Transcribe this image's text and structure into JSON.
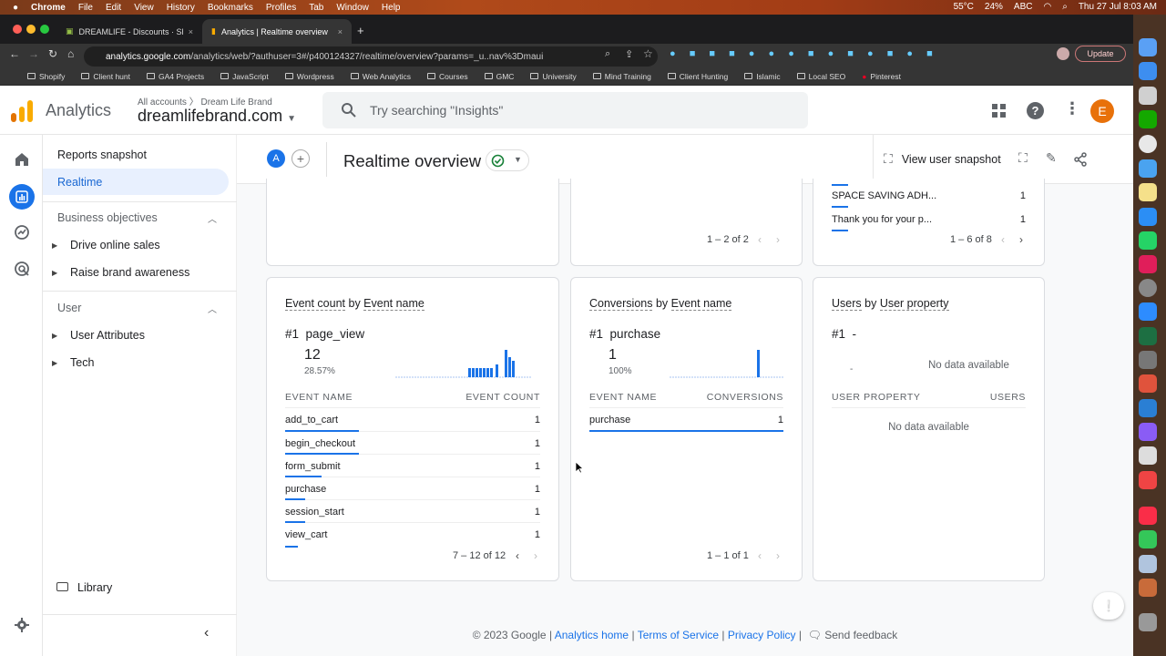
{
  "menubar": {
    "app": "Chrome",
    "items": [
      "File",
      "Edit",
      "View",
      "History",
      "Bookmarks",
      "Profiles",
      "Tab",
      "Window",
      "Help"
    ],
    "temp": "55°C",
    "battery": "24%",
    "input": "ABC",
    "datetime": "Thu 27 Jul  8:03 AM"
  },
  "browser": {
    "tabs": [
      {
        "title": "DREAMLIFE - Discounts · Shop"
      },
      {
        "title": "Analytics | Realtime overview"
      }
    ],
    "url_host": "analytics.google.com",
    "url_path": "/analytics/web/?authuser=3#/p400124327/realtime/overview?params=_u..nav%3Dmaui",
    "update_label": "Update",
    "bookmarks": [
      "Shopify",
      "Client hunt",
      "GA4 Projects",
      "JavaScript",
      "Wordpress",
      "Web Analytics",
      "Courses",
      "GMC",
      "University",
      "Mind Training",
      "Client Hunting",
      "Islamic",
      "Local SEO",
      "Pinterest"
    ]
  },
  "ga": {
    "product": "Analytics",
    "breadcrumb": "All accounts  〉 Dream Life Brand",
    "property": "dreamlifebrand.com",
    "search_placeholder": "Try searching \"Insights\"",
    "avatar_letter": "E"
  },
  "sidebar": {
    "reports_snapshot": "Reports snapshot",
    "realtime": "Realtime",
    "section1": "Business objectives",
    "items1": [
      "Drive online sales",
      "Raise brand awareness"
    ],
    "section2": "User",
    "items2": [
      "User Attributes",
      "Tech"
    ],
    "library": "Library"
  },
  "realtime": {
    "chip": "A",
    "title": "Realtime overview",
    "snapshot_label": "View user snapshot"
  },
  "top_cards": {
    "mid_pager": "1 – 2 of 2",
    "right_rows": [
      {
        "label": "SPACE SAVING ADH...",
        "value": "1"
      },
      {
        "label": "Thank you for your p...",
        "value": "1"
      }
    ],
    "right_pager": "1 – 6 of 8"
  },
  "event_card": {
    "title_a": "Event count",
    "title_by": " by ",
    "title_b": "Event name",
    "top_rank": "#1",
    "top_name": "page_view",
    "top_value": "12",
    "top_pct": "28.57%",
    "col1": "EVENT NAME",
    "col2": "EVENT COUNT",
    "rows": [
      {
        "name": "add_to_cart",
        "value": "1"
      },
      {
        "name": "begin_checkout",
        "value": "1"
      },
      {
        "name": "form_submit",
        "value": "1"
      },
      {
        "name": "purchase",
        "value": "1"
      },
      {
        "name": "session_start",
        "value": "1"
      },
      {
        "name": "view_cart",
        "value": "1"
      }
    ],
    "pager": "7 – 12 of 12"
  },
  "conv_card": {
    "title_a": "Conversions",
    "title_by": " by ",
    "title_b": "Event name",
    "top_rank": "#1",
    "top_name": "purchase",
    "top_value": "1",
    "top_pct": "100%",
    "col1": "EVENT NAME",
    "col2": "CONVERSIONS",
    "rows": [
      {
        "name": "purchase",
        "value": "1"
      }
    ],
    "pager": "1 – 1 of 1"
  },
  "user_card": {
    "title_a": "Users",
    "title_by": " by ",
    "title_b": "User property",
    "top_rank": "#1",
    "top_name": "-",
    "dash": "-",
    "nodata_top": "No data available",
    "col1": "USER PROPERTY",
    "col2": "USERS",
    "nodata": "No data available"
  },
  "footer": {
    "copyright": "© 2023 Google | ",
    "home": "Analytics home",
    "tos": "Terms of Service",
    "privacy": "Privacy Policy",
    "feedback": "Send feedback"
  }
}
